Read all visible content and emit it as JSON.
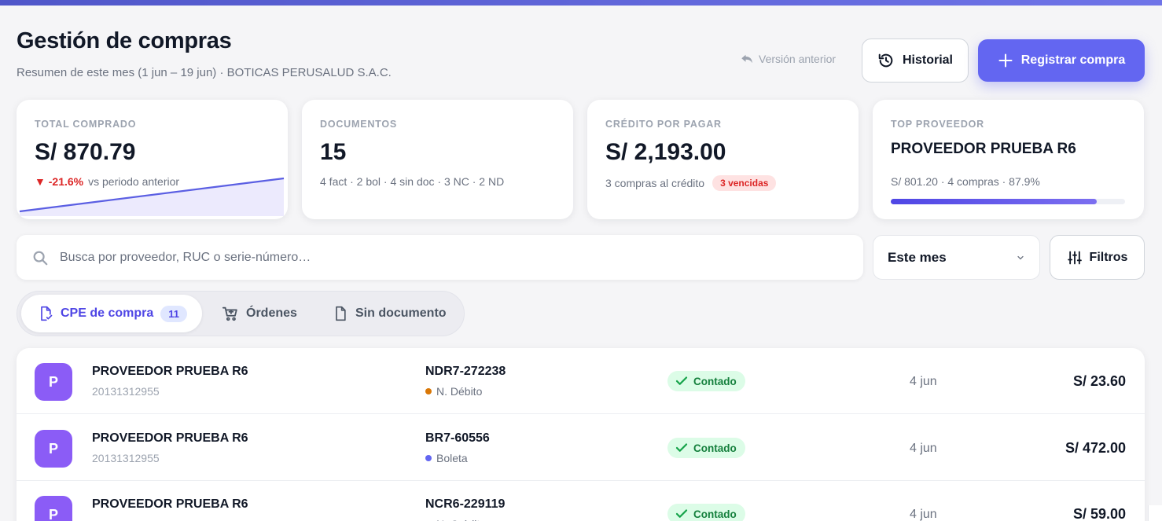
{
  "header": {
    "title": "Gestión de compras",
    "subtitle": "Resumen de este mes (1 jun – 19 jun) · BOTICAS PERUSALUD S.A.C.",
    "prev_version_label": "Versión anterior",
    "history_label": "Historial",
    "register_label": "Registrar compra",
    "accent_color": "#6366f1"
  },
  "cards": {
    "total": {
      "label": "TOTAL COMPRADO",
      "value": "S/ 870.79",
      "delta": "▼ -21.6%",
      "delta_suffix": "vs periodo anterior"
    },
    "docs": {
      "label": "DOCUMENTOS",
      "value": "15",
      "sub": "4 fact · 2 bol · 4 sin doc · 3 NC · 2 ND"
    },
    "credit": {
      "label": "CRÉDITO POR PAGAR",
      "value": "S/ 2,193.00",
      "sub": "3 compras al crédito",
      "badge": "3 vencidas"
    },
    "top": {
      "label": "TOP PROVEEDOR",
      "value": "PROVEEDOR PRUEBA R6",
      "sub": "S/ 801.20 · 4 compras · 87.9%",
      "progress": 0.879
    }
  },
  "search": {
    "placeholder": "Busca por proveedor, RUC o serie-número…"
  },
  "period_select": {
    "value": "Este mes"
  },
  "filters_label": "Filtros",
  "tabs": [
    {
      "label": "CPE de compra",
      "count": "11",
      "icon": "document-check-icon"
    },
    {
      "label": "Órdenes",
      "icon": "cart-icon"
    },
    {
      "label": "Sin documento",
      "icon": "document-icon"
    }
  ],
  "rows": [
    {
      "avatar": "P",
      "provider": "PROVEEDOR PRUEBA R6",
      "ruc": "20131312955",
      "serie": "NDR7-272238",
      "doc_type": "N. Débito",
      "doc_color": "#d97706",
      "status": "Contado",
      "date": "4 jun",
      "amount": "S/ 23.60"
    },
    {
      "avatar": "P",
      "provider": "PROVEEDOR PRUEBA R6",
      "ruc": "20131312955",
      "serie": "BR7-60556",
      "doc_type": "Boleta",
      "doc_color": "#6366f1",
      "status": "Contado",
      "date": "4 jun",
      "amount": "S/ 472.00"
    },
    {
      "avatar": "P",
      "provider": "PROVEEDOR PRUEBA R6",
      "ruc": "",
      "serie": "NCR6-229119",
      "doc_type": "N. Crédito",
      "doc_color": "#d97706",
      "status": "Contado",
      "date": "4 jun",
      "amount": "S/ 59.00"
    }
  ]
}
